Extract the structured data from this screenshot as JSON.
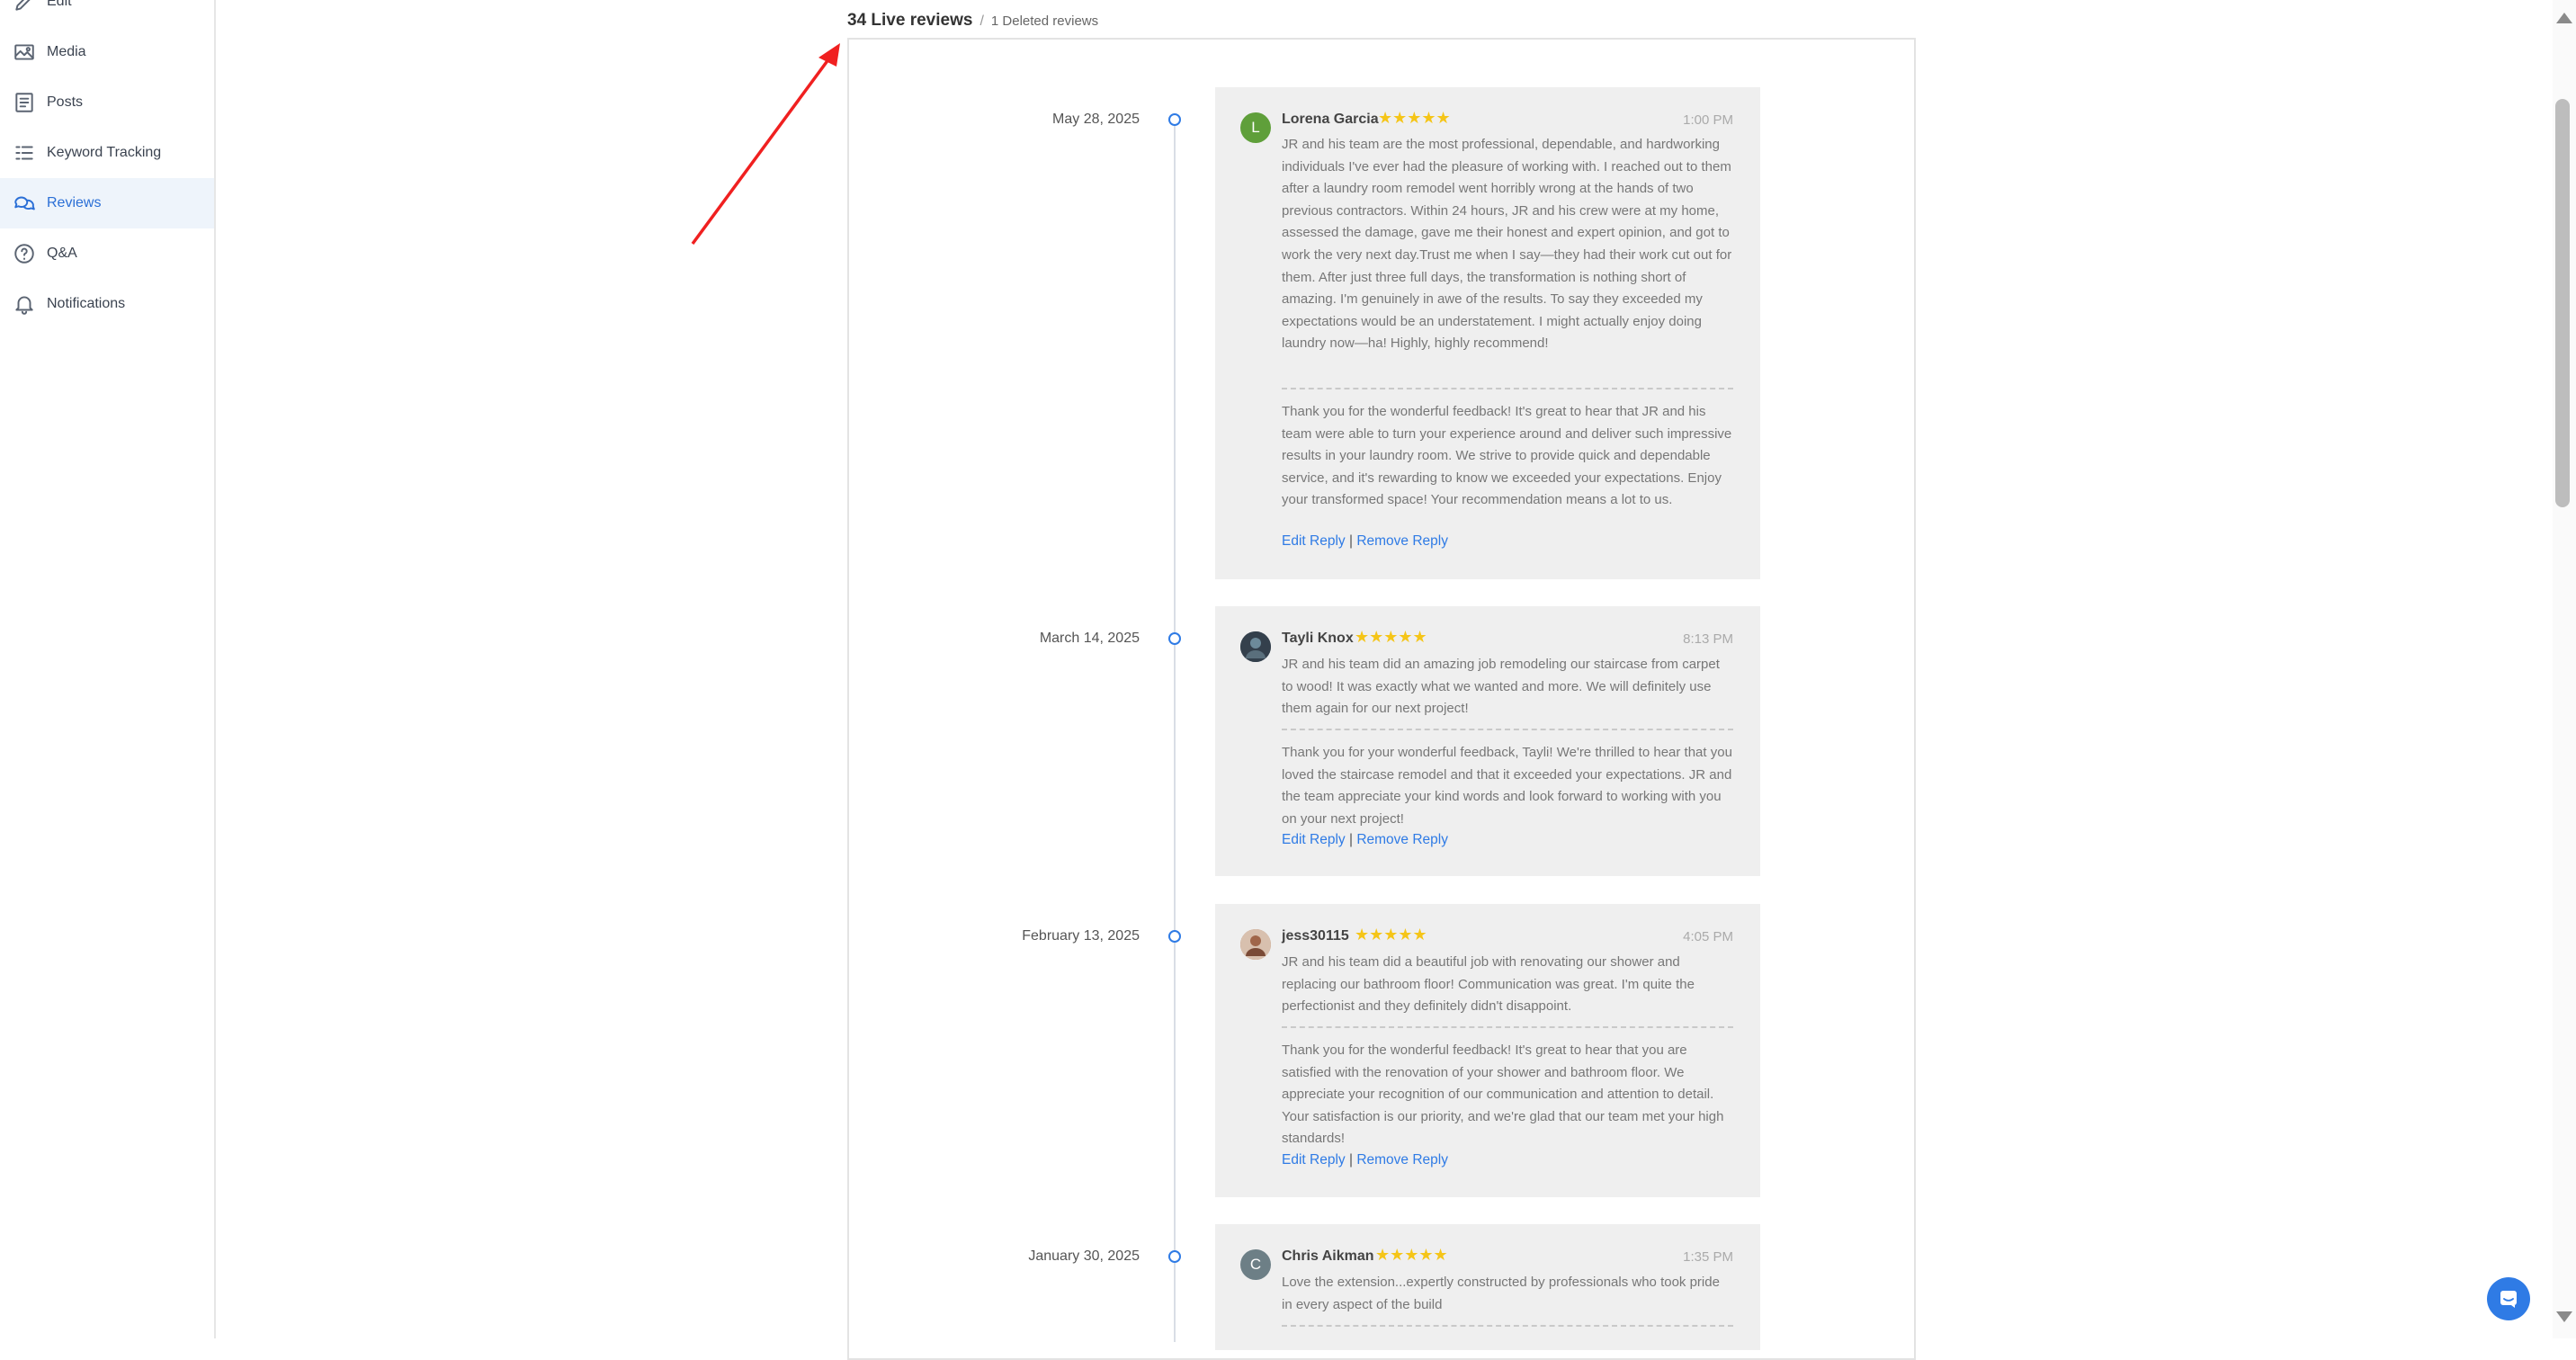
{
  "sidebar": {
    "items": [
      {
        "label": "Edit",
        "icon": "pencil-icon"
      },
      {
        "label": "Media",
        "icon": "media-icon"
      },
      {
        "label": "Posts",
        "icon": "posts-icon"
      },
      {
        "label": "Keyword Tracking",
        "icon": "list-icon"
      },
      {
        "label": "Reviews",
        "icon": "reviews-icon",
        "active": true
      },
      {
        "label": "Q&A",
        "icon": "question-icon"
      },
      {
        "label": "Notifications",
        "icon": "bell-icon"
      }
    ]
  },
  "header": {
    "live": "34 Live reviews",
    "separator": "/",
    "deleted": "1 Deleted reviews"
  },
  "reviews": [
    {
      "date": "May 28, 2025",
      "name": "Lorena Garcia",
      "initial": "L",
      "avatar_color": "#5f9f3a",
      "stars": "★★★★★",
      "time": "1:00 PM",
      "text": "JR and his team are the most professional, dependable, and hardworking individuals I've ever had the pleasure of working with. I reached out to them after a laundry room remodel went horribly wrong at the hands of two previous contractors. Within 24 hours, JR and his crew were at my home, assessed the damage, gave me their honest and expert opinion, and got to work the very next day.Trust me when I say—they had their work cut out for them. After just three full days, the transformation is nothing short of amazing. I'm genuinely in awe of the results. To say they exceeded my expectations would be an understatement. I might actually enjoy doing laundry now—ha! Highly, highly recommend!",
      "reply": "Thank you for the wonderful feedback! It's great to hear that JR and his team were able to turn your experience around and deliver such impressive results in your laundry room. We strive to provide quick and dependable service, and it's rewarding to know we exceeded your expectations. Enjoy your transformed space! Your recommendation means a lot to us.",
      "edit": "Edit Reply",
      "bar": "|",
      "remove": "Remove Reply"
    },
    {
      "date": "March 14, 2025",
      "name": "Tayli Knox",
      "initial": "",
      "avatar_color": "#3a4a5a",
      "stars": "★★★★★",
      "time": "8:13 PM",
      "text": "JR and his team did an amazing job remodeling our staircase from carpet to wood! It was exactly what we wanted and more. We will definitely use them again for our next project!",
      "reply": "Thank you for your wonderful feedback, Tayli! We're thrilled to hear that you loved the staircase remodel and that it exceeded your expectations. JR and the team appreciate your kind words and look forward to working with you on your next project!",
      "edit": "Edit Reply",
      "bar": "|",
      "remove": "Remove Reply"
    },
    {
      "date": "February 13, 2025",
      "name": "jess30115",
      "initial": "",
      "avatar_color": "#b07a5a",
      "stars": "★★★★★",
      "time": "4:05 PM",
      "text": "JR and his team did a beautiful job with renovating our shower and replacing our bathroom floor! Communication was great. I'm quite the perfectionist and they definitely didn't disappoint.",
      "reply": "Thank you for the wonderful feedback! It's great to hear that you are satisfied with the renovation of your shower and bathroom floor. We appreciate your recognition of our communication and attention to detail. Your satisfaction is our priority, and we're glad that our team met your high standards!",
      "edit": "Edit Reply",
      "bar": "|",
      "remove": "Remove Reply"
    },
    {
      "date": "January 30, 2025",
      "name": "Chris Aikman",
      "initial": "C",
      "avatar_color": "#6d7f86",
      "stars": "★★★★★",
      "time": "1:35 PM",
      "text": "Love the extension...expertly constructed by professionals who took pride in every aspect of the build"
    }
  ]
}
